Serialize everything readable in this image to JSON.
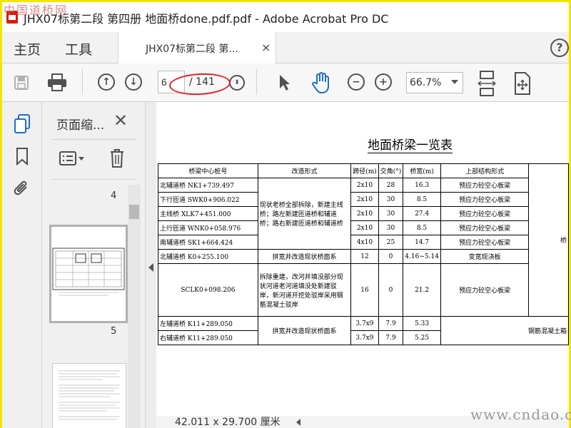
{
  "window": {
    "title": "JHX07标第二段 第四册 地面桥done.pdf.pdf - Adobe Acrobat Pro DC",
    "watermark_tl": "中国道桥网"
  },
  "nav": {
    "home": "主页",
    "tools": "工具"
  },
  "tab": {
    "label": "JHX07标第二段 第...",
    "close": "×"
  },
  "help": "?",
  "toolbar": {
    "page_value": "6",
    "page_total": "/ 141",
    "zoom": "66.7%"
  },
  "panel": {
    "title": "页面缩...",
    "close": "✕",
    "thumb_labels": [
      "4",
      "5"
    ]
  },
  "doc": {
    "title": "地面桥梁一览表",
    "headers": [
      "桥梁中心桩号",
      "改造形式",
      "跨径(m)",
      "交角(°)",
      "桥宽(m)",
      "上部结构形式"
    ],
    "rows": [
      {
        "station": "北辅道桥  NK1+739.497",
        "span": "2x10",
        "angle": "28",
        "width": "16.3",
        "structure": "预应力砼空心板梁"
      },
      {
        "station": "下行匝道  SWK0+906.022",
        "span": "2x10",
        "angle": "30",
        "width": "8.5",
        "structure": "预应力砼空心板梁"
      },
      {
        "station": "主线桥  XLK7+451.000",
        "span": "2x10",
        "angle": "30",
        "width": "27.4",
        "structure": "预应力砼空心板梁"
      },
      {
        "station": "上行匝道  WNK0+058.976",
        "span": "2x10",
        "angle": "30",
        "width": "8.5",
        "structure": "预应力砼空心板梁"
      },
      {
        "station": "南辅道桥  SK1+664.424",
        "span": "4x10",
        "angle": "25",
        "width": "14.7",
        "structure": "预应力砼空心板梁"
      },
      {
        "station": "北辅道桥  K0+255.100",
        "span": "12",
        "angle": "0",
        "width": "4.16~5.14",
        "structure": "变宽现浇板"
      },
      {
        "station": "SCLK0+098.206",
        "span": "16",
        "angle": "0",
        "width": "21.2",
        "structure": "预应力砼空心板梁"
      },
      {
        "station": "左辅道桥  K11+289.050",
        "span": "3.7x9",
        "angle": "7.9",
        "width": "5.33",
        "structure": "钢筋混凝土箱"
      },
      {
        "station": "右辅道桥  K11+289.050",
        "span": "3.7x9",
        "angle": "7.9",
        "width": "5.25",
        "structure": ""
      }
    ],
    "merge1": "现状老桥全部拆除，新建主线桥；路左新建匝道桥和辅道桥；路右新建匝道桥和辅道桥",
    "merge2": "拼宽并改造现状桥面系",
    "merge3": "拆除重建，改河并填没部分现状河道老河道填没处新建驳岸，新河道开挖处驳岸采用钢筋混凝土驳岸",
    "merge4": "拼宽并改造现状桥面系",
    "edge_char": "桥"
  },
  "status": {
    "size": "42.011 x 29.700 厘米"
  },
  "watermark_br": "www.cndao.com"
}
